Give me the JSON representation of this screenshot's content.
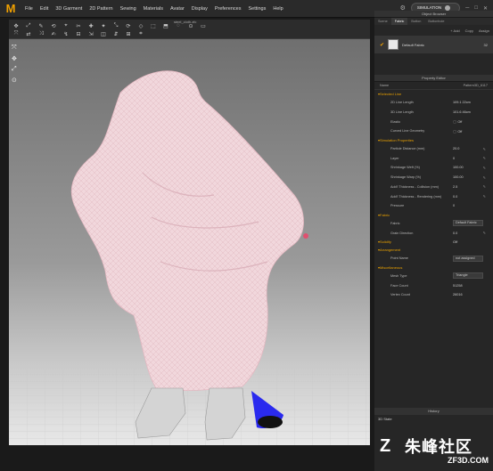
{
  "menu": {
    "logo": "M",
    "items": [
      "File",
      "Edit",
      "3D Garment",
      "2D Pattern",
      "Sewing",
      "Materials",
      "Avatar",
      "Display",
      "Preferences",
      "Settings",
      "Help"
    ],
    "simulation_label": "SIMULATION"
  },
  "toolbar": {
    "document_title": "steel_cloth.zfc",
    "row1": [
      "✥",
      "⤢",
      "✎",
      "⟲",
      "⌖",
      "✂",
      "✚",
      "✦",
      "⤡",
      "⟳",
      "◇",
      "⬚",
      "⬒",
      "◌",
      "⊙",
      "▭"
    ],
    "row2": [
      "⤧",
      "⇄",
      "⤨",
      "✍",
      "↯",
      "⊟",
      "⇲",
      "◫",
      "⇵",
      "⊞",
      "⌗"
    ]
  },
  "viewport_tools": [
    "⤧",
    "✥",
    "⤢",
    "⊙"
  ],
  "object_browser": {
    "title": "Object Browser",
    "tabs": [
      "Scene",
      "Fabric",
      "Button",
      "Buttonhole"
    ],
    "active_tab": "Fabric",
    "actions": [
      "+ Add",
      "Copy",
      "Assign"
    ],
    "fabric": {
      "name": "Default Fabric",
      "count": "32"
    }
  },
  "property_editor": {
    "title": "Property Editor",
    "name_label": "Name",
    "name_value": "Pattern3D_6117",
    "sections": [
      {
        "title": "Selected Line",
        "props": [
          {
            "label": "2D Line Length",
            "value": "109.1 22cm",
            "box": false,
            "pen": false
          },
          {
            "label": "3D Line Length",
            "value": "101.6 46cm",
            "box": false,
            "pen": false
          },
          {
            "label": "Elastic",
            "value": "Off",
            "box": false,
            "pen": false,
            "toggle": true
          },
          {
            "label": "Curved Line Geometry",
            "value": "Off",
            "box": false,
            "pen": false,
            "toggle": true
          }
        ]
      },
      {
        "title": "Simulation Properties",
        "props": [
          {
            "label": "Particle Distance (mm)",
            "value": "20.0",
            "box": false,
            "pen": true
          },
          {
            "label": "Layer",
            "value": "0",
            "box": false,
            "pen": true
          },
          {
            "label": "Shrinkage Weft (%)",
            "value": "100.00",
            "box": false,
            "pen": true
          },
          {
            "label": "Shrinkage Warp (%)",
            "value": "100.00",
            "box": false,
            "pen": true
          },
          {
            "label": "Add'l Thickness - Collision (mm)",
            "value": "2.5",
            "box": false,
            "pen": true
          },
          {
            "label": "Add'l Thickness - Rendering (mm)",
            "value": "0.0",
            "box": false,
            "pen": true
          },
          {
            "label": "Pressure",
            "value": "0",
            "box": false,
            "pen": false
          }
        ]
      },
      {
        "title": "Fabric",
        "props": [
          {
            "label": "Fabric",
            "value": "Default Fabric",
            "box": true,
            "pen": false
          },
          {
            "label": "Grain Direction",
            "value": "0.0",
            "box": false,
            "pen": true
          }
        ]
      },
      {
        "title": "Solidify",
        "props": []
      },
      {
        "title": "Arrangement",
        "props": [
          {
            "label": "Point Name",
            "value": "not assigned",
            "box": true,
            "pen": false
          }
        ]
      },
      {
        "title": "Miscellaneous",
        "props": [
          {
            "label": "Mesh Type",
            "value": "Triangle",
            "box": true,
            "pen": false
          },
          {
            "label": "Face Count",
            "value": "51258",
            "box": false,
            "pen": false
          },
          {
            "label": "Vertex Count",
            "value": "26016",
            "box": false,
            "pen": false
          }
        ]
      }
    ],
    "solidify_value": "Off"
  },
  "history": {
    "title": "History",
    "state_label": "3D State"
  },
  "watermark": {
    "brand": "朱峰社区",
    "url": "ZF3D.COM"
  },
  "colors": {
    "accent": "#e8a000",
    "cloth": "#f1d7dc",
    "cone": "#2a2aee"
  }
}
